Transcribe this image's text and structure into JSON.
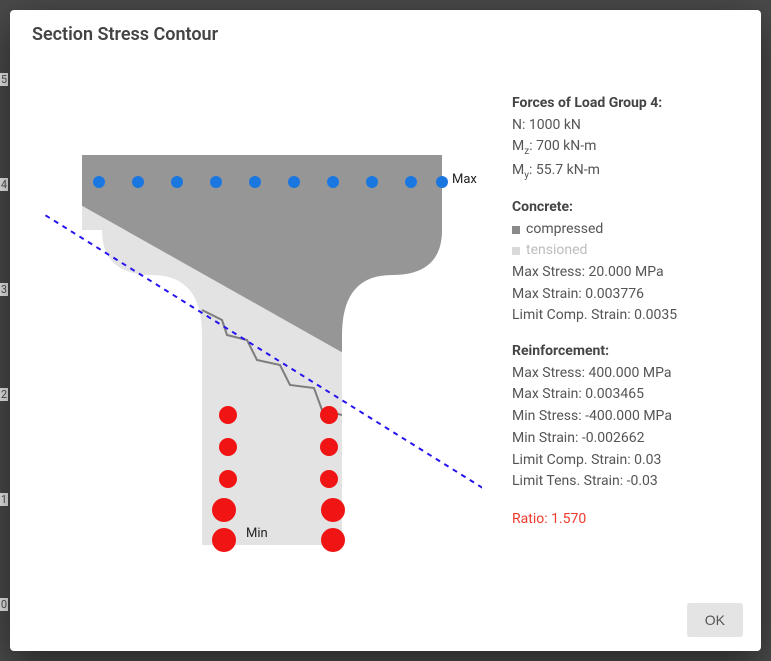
{
  "title": "Section Stress Contour",
  "axis_ticks": [
    "5",
    "4",
    "3",
    "2",
    "1",
    "0"
  ],
  "diagram": {
    "max_label": "Max",
    "min_label": "Min"
  },
  "forces": {
    "heading": "Forces of Load Group 4:",
    "n_label": "N:",
    "n_value": "1000 kN",
    "mz_label_pre": "M",
    "mz_label_sub": "z",
    "mz_label_post": ":",
    "mz_value": "700 kN-m",
    "my_label_pre": "M",
    "my_label_sub": "y",
    "my_label_post": ":",
    "my_value": "55.7 kN-m"
  },
  "concrete": {
    "heading": "Concrete:",
    "leg1": "compressed",
    "leg2": "tensioned",
    "max_stress_label": "Max Stress:",
    "max_stress_value": "20.000 MPa",
    "max_strain_label": "Max Strain:",
    "max_strain_value": "0.003776",
    "limit_comp_label": "Limit Comp. Strain:",
    "limit_comp_value": "0.0035"
  },
  "reinf": {
    "heading": "Reinforcement:",
    "max_stress_label": "Max Stress:",
    "max_stress_value": "400.000 MPa",
    "max_strain_label": "Max Strain:",
    "max_strain_value": "0.003465",
    "min_stress_label": "Min Stress:",
    "min_stress_value": "-400.000 MPa",
    "min_strain_label": "Min Strain:",
    "min_strain_value": "-0.002662",
    "limit_comp_label": "Limit Comp. Strain:",
    "limit_comp_value": "0.03",
    "limit_tens_label": "Limit Tens. Strain:",
    "limit_tens_value": "-0.03"
  },
  "ratio_label": "Ratio:",
  "ratio_value": "1.570",
  "ok_label": "OK",
  "chart_data": {
    "type": "diagram",
    "description": "T-shaped concrete cross-section with compressed (dark) zone above diagonal neutral axis and tensioned (light) zone below. Top row of blue reinforcement dots, two columns of red reinforcement dots in the web.",
    "top_bars": {
      "count": 10,
      "color": "#1b77e0"
    },
    "bottom_bars": {
      "columns": 2,
      "rows": 5,
      "color": "#f01414"
    },
    "neutral_axis": {
      "style": "dashed",
      "color": "#2613ee"
    },
    "annotations": [
      {
        "text": "Max",
        "near": "top-right of flange"
      },
      {
        "text": "Min",
        "near": "bottom-left bars"
      }
    ]
  }
}
